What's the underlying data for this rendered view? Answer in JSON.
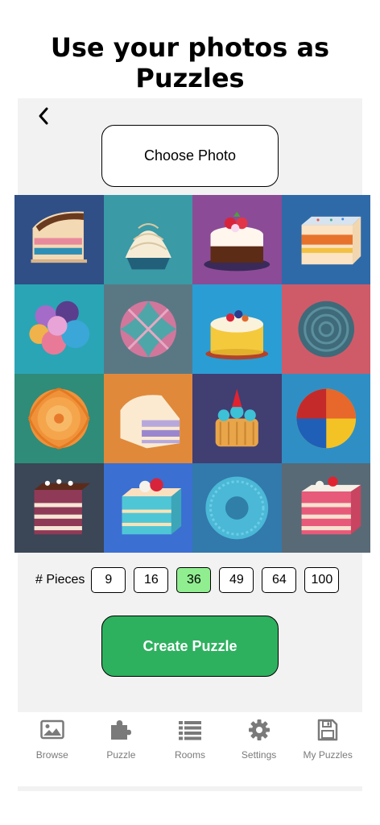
{
  "headline": {
    "line1": "Use your photos as",
    "line2": "Puzzles"
  },
  "nav": {
    "back_icon": "chevron-left-icon"
  },
  "choose_photo": {
    "label": "Choose Photo"
  },
  "photo_grid": {
    "tiles": [
      {
        "subject": "layered-cake-slice",
        "bg": "#2f4f86"
      },
      {
        "subject": "swirl-cupcake",
        "bg": "#3a9aa6"
      },
      {
        "subject": "strawberry-cake",
        "bg": "#8c4b96"
      },
      {
        "subject": "sprinkle-cake-square",
        "bg": "#2f6aa8"
      },
      {
        "subject": "ball-cluster",
        "bg": "#2aa5b5"
      },
      {
        "subject": "swirl-dome",
        "bg": "#5a7884"
      },
      {
        "subject": "yellow-cake",
        "bg": "#2a9dd4"
      },
      {
        "subject": "scalloped-dome",
        "bg": "#cf5b69"
      },
      {
        "subject": "orange-spiral",
        "bg": "#2f8c78"
      },
      {
        "subject": "purple-layer-slice",
        "bg": "#e0893a"
      },
      {
        "subject": "berry-tart",
        "bg": "#413e72"
      },
      {
        "subject": "tri-color-pie",
        "bg": "#2f8fc4"
      },
      {
        "subject": "chocolate-layer-cake",
        "bg": "#3b4656"
      },
      {
        "subject": "blue-cake-square",
        "bg": "#3b6fd2"
      },
      {
        "subject": "blue-donut",
        "bg": "#3279ac"
      },
      {
        "subject": "pink-cake-square",
        "bg": "#586a76"
      }
    ]
  },
  "pieces": {
    "label": "# Pieces",
    "options": [
      "9",
      "16",
      "36",
      "49",
      "64",
      "100"
    ],
    "selected": "36"
  },
  "create": {
    "label": "Create Puzzle"
  },
  "tabbar": {
    "items": [
      {
        "label": "Browse",
        "icon": "image-icon"
      },
      {
        "label": "Puzzle",
        "icon": "puzzle-piece-icon"
      },
      {
        "label": "Rooms",
        "icon": "list-icon"
      },
      {
        "label": "Settings",
        "icon": "gear-icon"
      },
      {
        "label": "My Puzzles",
        "icon": "floppy-disk-icon"
      }
    ]
  },
  "colors": {
    "accent": "#2eb15f",
    "selected_piece": "#90ee90",
    "panel": "#f2f2f2"
  }
}
